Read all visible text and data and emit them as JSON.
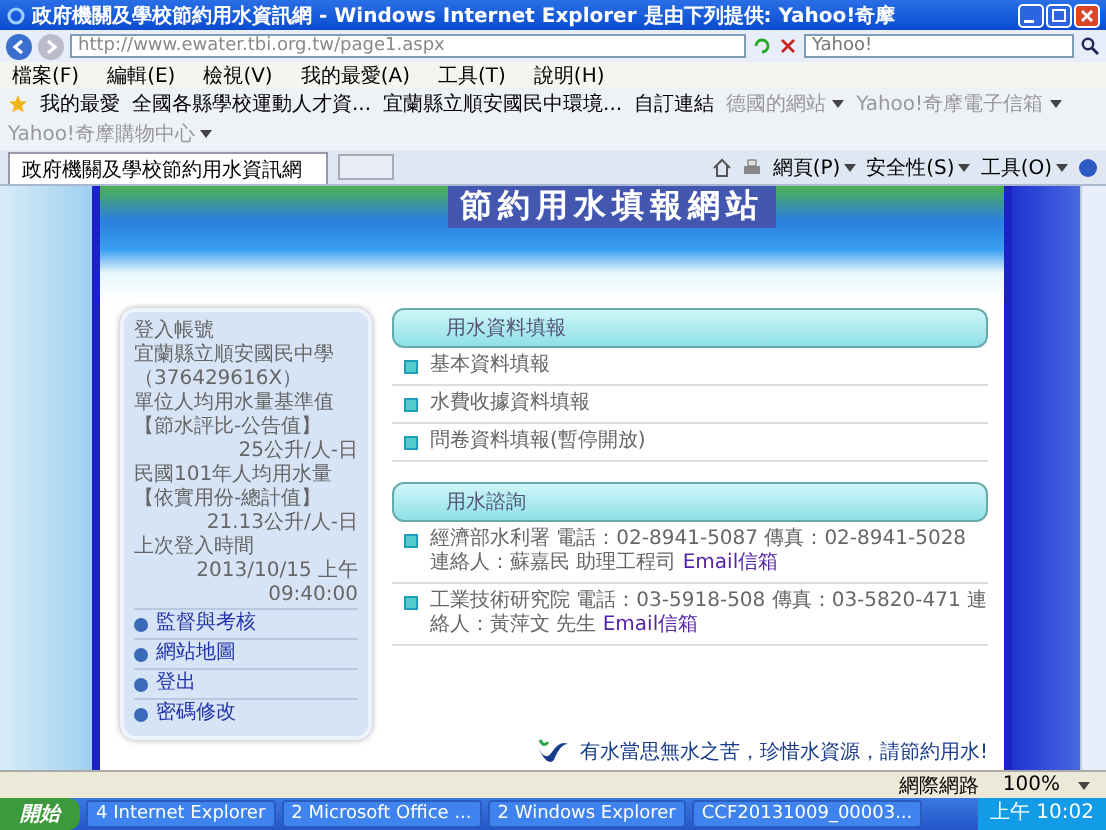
{
  "window": {
    "title": "政府機關及學校節約用水資訊網 - Windows Internet Explorer 是由下列提供: Yahoo!奇摩"
  },
  "address_bar": {
    "url": "http://www.ewater.tbi.org.tw/page1.aspx",
    "search_placeholder": "Yahoo!"
  },
  "menu": [
    "檔案(F)",
    "編輯(E)",
    "檢視(V)",
    "我的最愛(A)",
    "工具(T)",
    "說明(H)"
  ],
  "favorites_bar": {
    "label": "我的最愛",
    "links": [
      {
        "label": "全國各縣學校運動人才資...",
        "dropdown": false,
        "disabled": false
      },
      {
        "label": "宜蘭縣立順安國民中環境...",
        "dropdown": false,
        "disabled": false
      },
      {
        "label": "自訂連結",
        "dropdown": false,
        "disabled": false
      },
      {
        "label": "德國的網站",
        "dropdown": true,
        "disabled": true
      },
      {
        "label": "Yahoo!奇摩電子信箱",
        "dropdown": true,
        "disabled": true
      },
      {
        "label": "Yahoo!奇摩購物中心",
        "dropdown": true,
        "disabled": true
      }
    ]
  },
  "tabs": [
    {
      "label": "政府機關及學校節約用水資訊網",
      "selected": true
    }
  ],
  "command_bar": [
    "網頁(P)",
    "安全性(S)",
    "工具(O)"
  ],
  "banner": {
    "title": "節約用水填報網站"
  },
  "sidebar": {
    "info": [
      {
        "text": "登入帳號",
        "kind": "label"
      },
      {
        "text": "宜蘭縣立順安國民中學",
        "kind": "label"
      },
      {
        "text": "（376429616X）",
        "kind": "label"
      },
      {
        "text": "單位人均用水量基準值",
        "kind": "label"
      },
      {
        "text": "【節水評比-公告值】",
        "kind": "label"
      },
      {
        "text": "25公升/人-日",
        "kind": "value"
      },
      {
        "text": "民國101年人均用水量",
        "kind": "label"
      },
      {
        "text": "【依實用份-總計值】",
        "kind": "label"
      },
      {
        "text": "21.13公升/人-日",
        "kind": "value"
      },
      {
        "text": "上次登入時間",
        "kind": "label"
      },
      {
        "text": "2013/10/15 上午",
        "kind": "value"
      },
      {
        "text": "09:40:00",
        "kind": "value"
      }
    ],
    "links": [
      "監督與考核",
      "網站地圖",
      "登出",
      "密碼修改"
    ]
  },
  "sections": [
    {
      "title": "用水資料填報",
      "items": [
        {
          "text": "基本資料填報"
        },
        {
          "text": "水費收據資料填報"
        },
        {
          "text": "問卷資料填報(暫停開放)"
        }
      ]
    },
    {
      "title": "用水諮詢",
      "items": [
        {
          "text": "經濟部水利署 電話：02-8941-5087 傳真：02-8941-5028 連絡人：蘇嘉民 助理工程司",
          "email": "Email信箱"
        },
        {
          "text": "工業技術研究院 電話：03-5918-508 傳真：03-5820-471 連絡人：黃萍文 先生",
          "email": "Email信箱"
        }
      ]
    }
  ],
  "footer": {
    "slogan": "有水當思無水之苦，珍惜水資源，請節約用水!"
  },
  "status_bar": {
    "zone": "網際網路",
    "zoom": "100%"
  },
  "taskbar": {
    "start": "開始",
    "tasks": [
      "4 Internet Explorer",
      "2 Microsoft Office ...",
      "2 Windows Explorer",
      "CCF20131009_00003..."
    ],
    "clock": "上午 10:02"
  }
}
